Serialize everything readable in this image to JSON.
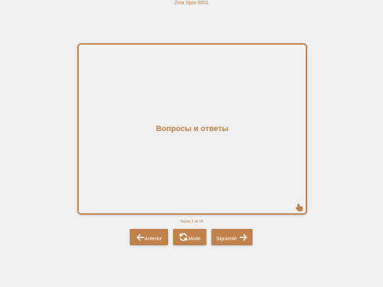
{
  "header": {
    "title": "Zina Урок 0001"
  },
  "card": {
    "text": "Вопросы и ответы",
    "hint_icon": "hand-pointer-icon"
  },
  "counter": {
    "text": "Tarjeta 1 de 56"
  },
  "controls": {
    "prev_label": "Anterior",
    "mode_label": "Mode",
    "next_label": "Siguiente"
  },
  "colors": {
    "accent": "#c0824a",
    "background": "#f0f0f0",
    "button_text": "#ffffff"
  }
}
